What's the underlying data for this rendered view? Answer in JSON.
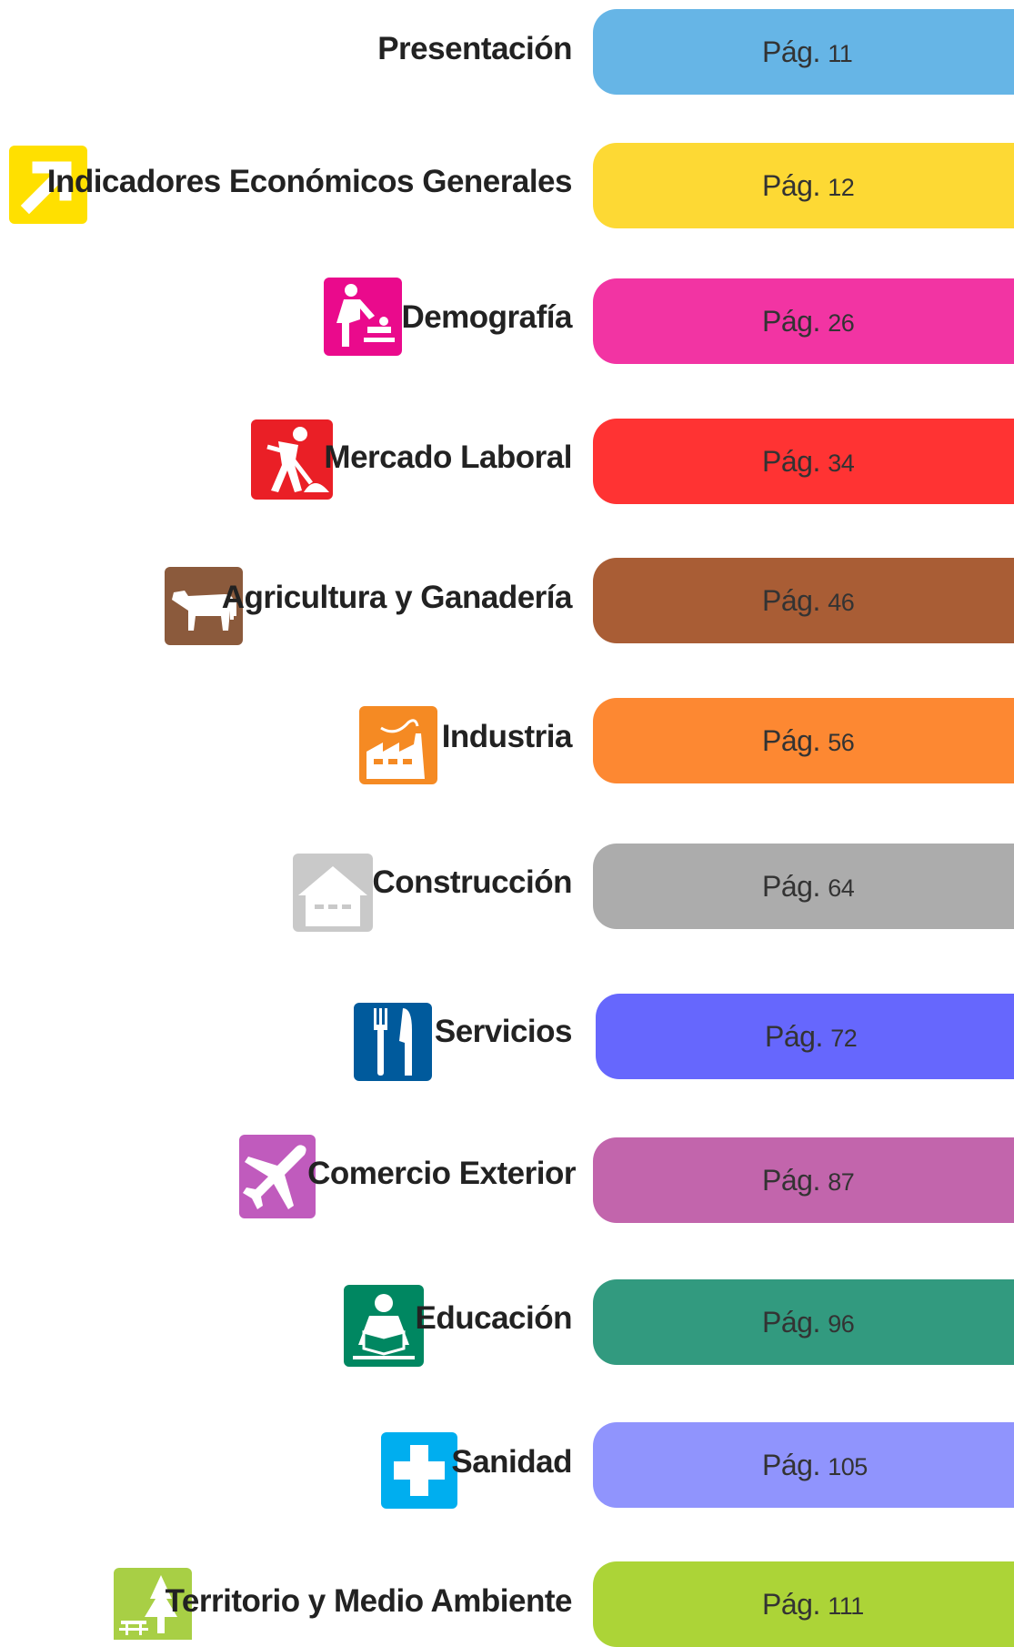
{
  "sections": [
    {
      "title": "Presentación",
      "page_label": "Pág.",
      "page_number": "11",
      "color": "#66b5e6",
      "icon": "none"
    },
    {
      "title": "Indicadores Económicos Generales",
      "page_label": "Pág.",
      "page_number": "12",
      "color": "#fdd934",
      "icon": "arrow-up-right-icon",
      "icon_color": "#ffe000"
    },
    {
      "title": "Demografía",
      "page_label": "Pág.",
      "page_number": "26",
      "color": "#f234a3",
      "icon": "baby-changing-icon",
      "icon_color": "#ea0a8c"
    },
    {
      "title": "Mercado Laboral",
      "page_label": "Pág.",
      "page_number": "34",
      "color": "#ff3333",
      "icon": "worker-shoveling-icon",
      "icon_color": "#ea1f26"
    },
    {
      "title": "Agricultura y Ganadería",
      "page_label": "Pág.",
      "page_number": "46",
      "color": "#a95d35",
      "icon": "cow-icon",
      "icon_color": "#8b5a3c"
    },
    {
      "title": "Industria",
      "page_label": "Pág.",
      "page_number": "56",
      "color": "#fd8832",
      "icon": "factory-icon",
      "icon_color": "#f58a23"
    },
    {
      "title": "Construcción",
      "page_label": "Pág.",
      "page_number": "64",
      "color": "#acacac",
      "icon": "house-icon",
      "icon_color": "#c9c9c9"
    },
    {
      "title": "Servicios",
      "page_label": "Pág.",
      "page_number": "72",
      "color": "#6667fd",
      "icon": "fork-knife-icon",
      "icon_color": "#005a9c"
    },
    {
      "title": "Comercio Exterior",
      "page_label": "Pág.",
      "page_number": "87",
      "color": "#c265ac",
      "icon": "airplane-icon",
      "icon_color": "#c05bbd"
    },
    {
      "title": "Educación",
      "page_label": "Pág.",
      "page_number": "96",
      "color": "#329a7f",
      "icon": "reading-person-icon",
      "icon_color": "#008761"
    },
    {
      "title": "Sanidad",
      "page_label": "Pág.",
      "page_number": "105",
      "color": "#9094fd",
      "icon": "medical-cross-icon",
      "icon_color": "#00aeef"
    },
    {
      "title": "Territorio y Medio Ambiente",
      "page_label": "Pág.",
      "page_number": "111",
      "color": "#acd437",
      "icon": "park-tree-icon",
      "icon_color": "#a8cf45"
    }
  ]
}
